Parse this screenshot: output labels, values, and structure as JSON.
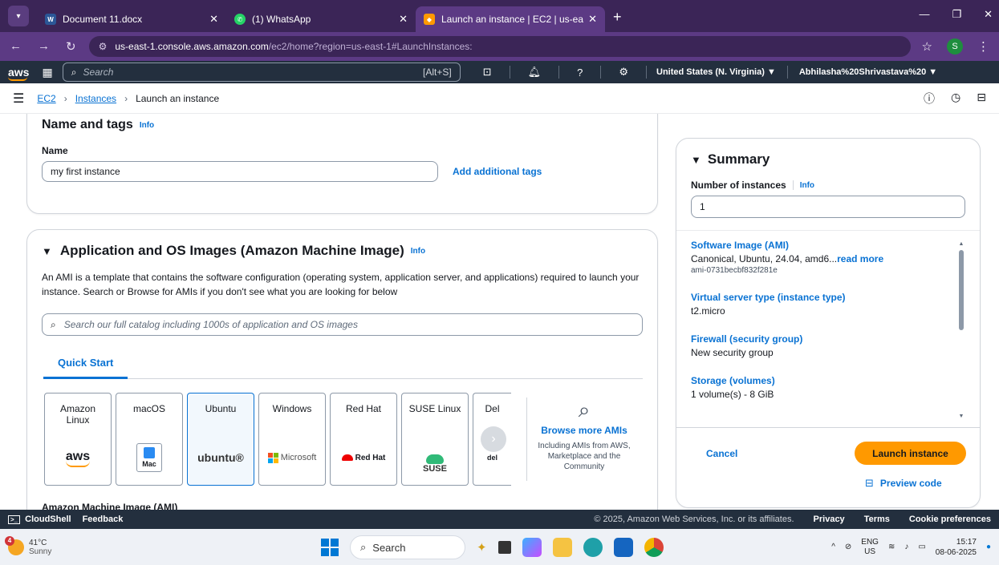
{
  "browser": {
    "tabs": [
      {
        "title": "Document 11.docx",
        "icon": "word-icon"
      },
      {
        "title": "(1) WhatsApp",
        "icon": "whatsapp-icon"
      },
      {
        "title": "Launch an instance | EC2 | us-ea",
        "icon": "aws-icon",
        "active": true
      }
    ],
    "url_host": "us-east-1.console.aws.amazon.com",
    "url_path": "/ec2/home?region=us-east-1#LaunchInstances:",
    "profile_initial": "S"
  },
  "awsnav": {
    "logo": "aws",
    "search_placeholder": "Search",
    "search_shortcut": "[Alt+S]",
    "region": "United States (N. Virginia) ▼",
    "user": "Abhilasha%20Shrivastava%20 ▼"
  },
  "breadcrumb": {
    "items": [
      "EC2",
      "Instances"
    ],
    "current": "Launch an instance"
  },
  "name_tags": {
    "title": "Name and tags",
    "info": "Info",
    "name_label": "Name",
    "name_value": "my first instance",
    "add_tags": "Add additional tags"
  },
  "ami": {
    "title": "Application and OS Images (Amazon Machine Image)",
    "info": "Info",
    "description": "An AMI is a template that contains the software configuration (operating system, application server, and applications) required to launch your instance. Search or Browse for AMIs if you don't see what you are looking for below",
    "search_placeholder": "Search our full catalog including 1000s of application and OS images",
    "tab_quick_start": "Quick Start",
    "tiles": [
      {
        "name": "Amazon Linux",
        "logo": "aws"
      },
      {
        "name": "macOS",
        "logo": "Mac"
      },
      {
        "name": "Ubuntu",
        "logo": "ubuntu®",
        "selected": true
      },
      {
        "name": "Windows",
        "logo": "Microsoft"
      },
      {
        "name": "Red Hat",
        "logo": "Red Hat"
      },
      {
        "name": "SUSE Linux",
        "logo": "SUSE"
      },
      {
        "name": "Del",
        "logo": "del"
      }
    ],
    "browse_more": "Browse more AMIs",
    "browse_sub": "Including AMIs from AWS, Marketplace and the Community",
    "ami_section_label": "Amazon Machine Image (AMI)"
  },
  "summary": {
    "title": "Summary",
    "num_label": "Number of instances",
    "info": "Info",
    "num_value": "1",
    "items": [
      {
        "key": "Software Image (AMI)",
        "value": "Canonical, Ubuntu, 24.04, amd6...",
        "more": "read more",
        "sub": "ami-0731becbf832f281e"
      },
      {
        "key": "Virtual server type (instance type)",
        "value": "t2.micro"
      },
      {
        "key": "Firewall (security group)",
        "value": "New security group"
      },
      {
        "key": "Storage (volumes)",
        "value": "1 volume(s) - 8 GiB"
      }
    ],
    "cancel": "Cancel",
    "launch": "Launch instance",
    "preview": "Preview code"
  },
  "footer": {
    "cloudshell": "CloudShell",
    "feedback": "Feedback",
    "copyright": "© 2025, Amazon Web Services, Inc. or its affiliates.",
    "links": [
      "Privacy",
      "Terms",
      "Cookie preferences"
    ]
  },
  "taskbar": {
    "temp": "41°C",
    "weather": "Sunny",
    "badge": "4",
    "search": "Search",
    "lang": "ENG",
    "region": "US",
    "time": "15:17",
    "date": "08-06-2025"
  },
  "colors": {
    "aws_orange": "#ff9900",
    "aws_navy": "#232f3e",
    "link_blue": "#0972d3",
    "chrome_purple": "#5c3a84"
  }
}
